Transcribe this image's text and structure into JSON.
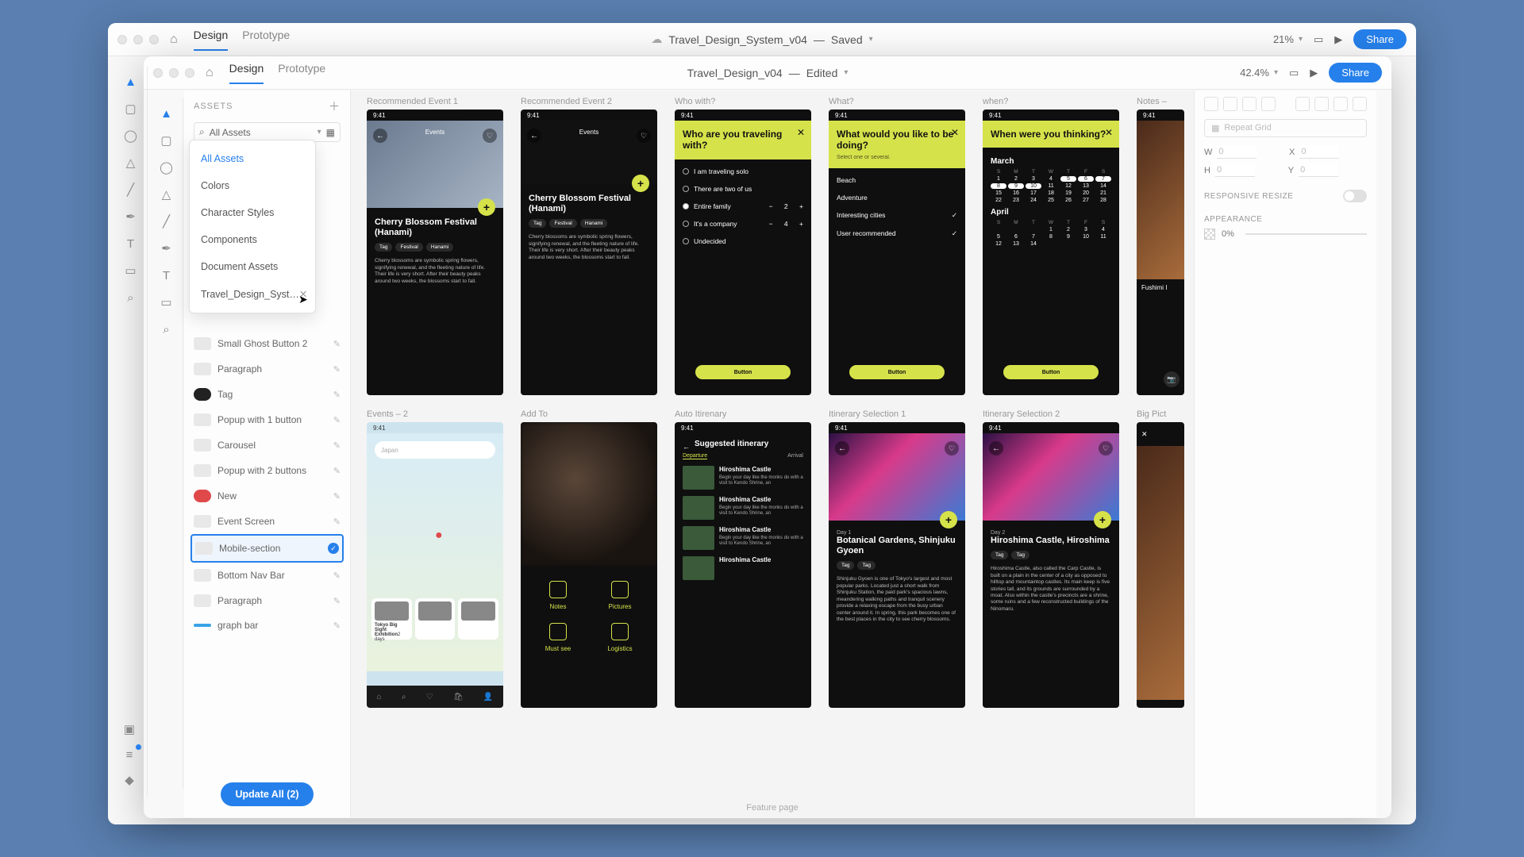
{
  "back_window": {
    "tabs": [
      "Design",
      "Prototype"
    ],
    "active_tab": 0,
    "title": "Travel_Design_System_v04",
    "status": "Saved",
    "zoom": "21%",
    "share": "Share"
  },
  "front_window": {
    "tabs": [
      "Design",
      "Prototype"
    ],
    "active_tab": 0,
    "title": "Travel_Design_v04",
    "status": "Edited",
    "zoom": "42.4%",
    "share": "Share"
  },
  "assets": {
    "header": "ASSETS",
    "search_label": "All Assets",
    "dropdown": [
      "All Assets",
      "Colors",
      "Character Styles",
      "Components",
      "Document Assets",
      "Travel_Design_Syst…"
    ],
    "dropdown_sel": 0,
    "components": [
      {
        "label": "Small Ghost Button 2",
        "cls": ""
      },
      {
        "label": "Paragraph",
        "cls": ""
      },
      {
        "label": "Tag",
        "cls": "tag"
      },
      {
        "label": "Popup with 1 button",
        "cls": ""
      },
      {
        "label": "Carousel",
        "cls": ""
      },
      {
        "label": "Popup with 2 buttons",
        "cls": ""
      },
      {
        "label": "New",
        "cls": "new"
      },
      {
        "label": "Event Screen",
        "cls": ""
      },
      {
        "label": "Mobile-section",
        "cls": "",
        "sel": true
      },
      {
        "label": "Bottom Nav Bar",
        "cls": ""
      },
      {
        "label": "Paragraph",
        "cls": ""
      },
      {
        "label": "graph bar",
        "cls": "bar"
      }
    ],
    "update_btn": "Update All (2)"
  },
  "artboards_top": [
    {
      "label": "Recommended Event 1"
    },
    {
      "label": "Recommended Event 2"
    },
    {
      "label": "Who with?"
    },
    {
      "label": "What?"
    },
    {
      "label": "when?"
    },
    {
      "label": "Notes – "
    }
  ],
  "artboards_bottom": [
    {
      "label": "Events – 2"
    },
    {
      "label": "Add To"
    },
    {
      "label": "Auto Itirenary"
    },
    {
      "label": "Itinerary Selection 1"
    },
    {
      "label": "Itinerary Selection 2"
    },
    {
      "label": "Big Pict"
    }
  ],
  "event": {
    "time": "9:41",
    "title": "Events",
    "heading": "Cherry Blossom Festival (Hanami)",
    "tags": [
      "Tag",
      "Festival",
      "Hanami"
    ],
    "para": "Cherry blossoms are symbolic spring flowers, signifying renewal, and the fleeting nature of life. Their life is very short. After their beauty peaks around two weeks, the blossoms start to fall."
  },
  "who": {
    "heading": "Who are you traveling with?",
    "opts": [
      "I am traveling solo",
      "There are two of us",
      "Entire family",
      "It's a company",
      "Undecided"
    ],
    "btn": "Button",
    "counter1": [
      "−",
      "2",
      "+"
    ],
    "counter2": [
      "−",
      "4",
      "+"
    ]
  },
  "what": {
    "heading": "What would you like to be doing?",
    "sub": "Select one or several.",
    "opts": [
      "Beach",
      "Adventure",
      "Interesting cities",
      "User recommended"
    ],
    "btn": "Button"
  },
  "when": {
    "heading": "When were you thinking?",
    "months": [
      "March",
      "April"
    ],
    "wk": [
      "S",
      "M",
      "T",
      "W",
      "T",
      "F",
      "S"
    ],
    "btn": "Button"
  },
  "addto": {
    "items": [
      "Notes",
      "Pictures",
      "Must see",
      "Logistics"
    ]
  },
  "autoitin": {
    "title": "Suggested itinerary",
    "cols": [
      "Departure",
      "Arrival"
    ],
    "items": [
      {
        "t": "Hiroshima Castle",
        "d": "Begin your day like the monks do with a visit to Kendo Shrine, an"
      },
      {
        "t": "Hiroshima Castle",
        "d": "Begin your day like the monks do with a visit to Kendo Shrine, an"
      },
      {
        "t": "Hiroshima Castle",
        "d": "Begin your day like the monks do with a visit to Kendo Shrine, an"
      },
      {
        "t": "Hiroshima Castle",
        "d": ""
      }
    ]
  },
  "itin1": {
    "day": "Day 1",
    "title": "Botanical Gardens, Shinjuku Gyoen",
    "tags": [
      "Tag",
      "Tag"
    ],
    "para": "Shinjuku Gyoen is one of Tokyo's largest and most popular parks. Located just a short walk from Shinjuku Station, the paid park's spacious lawns, meandering walking paths and tranquil scenery provide a relaxing escape from the busy urban center around it. In spring, this park becomes one of the best places in the city to see cherry blossoms."
  },
  "itin2": {
    "day": "Day 2",
    "title": "Hiroshima Castle, Hiroshima",
    "tags": [
      "Tag",
      "Tag"
    ],
    "para": "Hiroshima Castle, also called the Carp Castle, is built on a plain in the center of a city as opposed to hilltop and mountaintop castles. Its main keep is five stories tall, and its grounds are surrounded by a moat. Also within the castle's precincts are a shrine, some ruins and a few reconstructed buildings of the Ninomaru."
  },
  "events2": {
    "search": "Japan",
    "cards": [
      "Tokyo Big Sight Exhibition",
      "",
      "",
      ""
    ],
    "meta": "2 days"
  },
  "inspector": {
    "repeat": "Repeat Grid",
    "w": "W",
    "h": "H",
    "x": "X",
    "y": "Y",
    "wv": "0",
    "hv": "0",
    "xv": "0",
    "yv": "0",
    "responsive": "RESPONSIVE RESIZE",
    "appearance": "APPEARANCE",
    "opacity": "0%"
  },
  "bottom_text": "Feature page",
  "notes_side": "Fushimi I"
}
